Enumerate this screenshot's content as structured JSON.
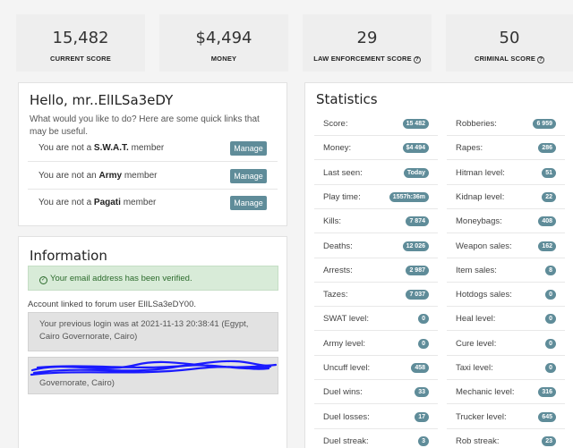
{
  "top_stats": [
    {
      "value": "15,482",
      "label": "CURRENT SCORE",
      "help": false
    },
    {
      "value": "$4,494",
      "label": "MONEY",
      "help": false
    },
    {
      "value": "29",
      "label": "LAW ENFORCEMENT SCORE",
      "help": true
    },
    {
      "value": "50",
      "label": "CRIMINAL SCORE",
      "help": true
    }
  ],
  "help_glyph": "?",
  "hello": {
    "title": "Hello, mr..ElILSa3eDY",
    "intro": "What would you like to do? Here are some quick links that may be useful.",
    "links": [
      {
        "prefix": "You are not a ",
        "group": "S.W.A.T.",
        "suffix": " member",
        "button": "Manage"
      },
      {
        "prefix": "You are not an ",
        "group": "Army",
        "suffix": " member",
        "button": "Manage"
      },
      {
        "prefix": "You are not a ",
        "group": "Pagati",
        "suffix": " member",
        "button": "Manage"
      }
    ]
  },
  "information": {
    "title": "Information",
    "verified": "Your email address has been verified.",
    "forum": "Account linked to forum user ElILSa3eDY00.",
    "previous_login": "Your previous login was at 2021-11-13 20:38:41 (Egypt, Cairo Governorate, Cairo)",
    "redacted_login_tail": "Governorate, Cairo)",
    "redaction_color": "#1a1aff"
  },
  "statistics": {
    "title": "Statistics",
    "left": [
      {
        "k": "Score:",
        "v": "15 482"
      },
      {
        "k": "Money:",
        "v": "$4 494"
      },
      {
        "k": "Last seen:",
        "v": "Today"
      },
      {
        "k": "Play time:",
        "v": "1557h:36m"
      },
      {
        "k": "Kills:",
        "v": "7 874"
      },
      {
        "k": "Deaths:",
        "v": "12 026"
      },
      {
        "k": "Arrests:",
        "v": "2 987"
      },
      {
        "k": "Tazes:",
        "v": "7 037"
      },
      {
        "k": "SWAT level:",
        "v": "0"
      },
      {
        "k": "Army level:",
        "v": "0"
      },
      {
        "k": "Uncuff level:",
        "v": "458"
      },
      {
        "k": "Duel wins:",
        "v": "33"
      },
      {
        "k": "Duel losses:",
        "v": "17"
      },
      {
        "k": "Duel streak:",
        "v": "3"
      }
    ],
    "right": [
      {
        "k": "Robberies:",
        "v": "6 959"
      },
      {
        "k": "Rapes:",
        "v": "286"
      },
      {
        "k": "Hitman level:",
        "v": "51"
      },
      {
        "k": "Kidnap level:",
        "v": "22"
      },
      {
        "k": "Moneybags:",
        "v": "408"
      },
      {
        "k": "Weapon sales:",
        "v": "162"
      },
      {
        "k": "Item sales:",
        "v": "8"
      },
      {
        "k": "Hotdogs sales:",
        "v": "0"
      },
      {
        "k": "Heal level:",
        "v": "0"
      },
      {
        "k": "Cure level:",
        "v": "0"
      },
      {
        "k": "Taxi level:",
        "v": "0"
      },
      {
        "k": "Mechanic level:",
        "v": "316"
      },
      {
        "k": "Trucker level:",
        "v": "645"
      },
      {
        "k": "Rob streak:",
        "v": "23"
      }
    ]
  },
  "colors": {
    "accent": "#5f8c99",
    "verified_bg": "#d8ebd8",
    "card_bg": "#eeeeee"
  }
}
